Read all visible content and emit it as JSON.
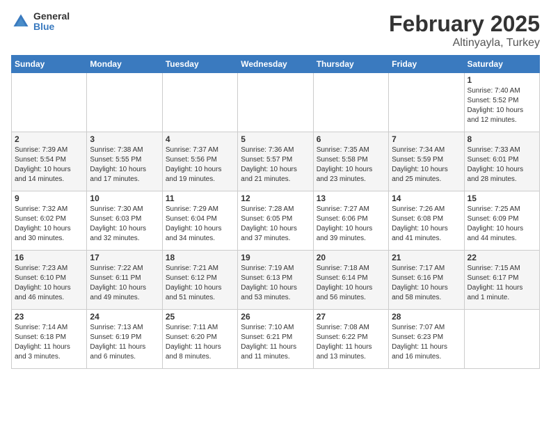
{
  "logo": {
    "general": "General",
    "blue": "Blue"
  },
  "title": "February 2025",
  "subtitle": "Altinyayla, Turkey",
  "days_header": [
    "Sunday",
    "Monday",
    "Tuesday",
    "Wednesday",
    "Thursday",
    "Friday",
    "Saturday"
  ],
  "weeks": [
    [
      {
        "day": "",
        "info": ""
      },
      {
        "day": "",
        "info": ""
      },
      {
        "day": "",
        "info": ""
      },
      {
        "day": "",
        "info": ""
      },
      {
        "day": "",
        "info": ""
      },
      {
        "day": "",
        "info": ""
      },
      {
        "day": "1",
        "info": "Sunrise: 7:40 AM\nSunset: 5:52 PM\nDaylight: 10 hours\nand 12 minutes."
      }
    ],
    [
      {
        "day": "2",
        "info": "Sunrise: 7:39 AM\nSunset: 5:54 PM\nDaylight: 10 hours\nand 14 minutes."
      },
      {
        "day": "3",
        "info": "Sunrise: 7:38 AM\nSunset: 5:55 PM\nDaylight: 10 hours\nand 17 minutes."
      },
      {
        "day": "4",
        "info": "Sunrise: 7:37 AM\nSunset: 5:56 PM\nDaylight: 10 hours\nand 19 minutes."
      },
      {
        "day": "5",
        "info": "Sunrise: 7:36 AM\nSunset: 5:57 PM\nDaylight: 10 hours\nand 21 minutes."
      },
      {
        "day": "6",
        "info": "Sunrise: 7:35 AM\nSunset: 5:58 PM\nDaylight: 10 hours\nand 23 minutes."
      },
      {
        "day": "7",
        "info": "Sunrise: 7:34 AM\nSunset: 5:59 PM\nDaylight: 10 hours\nand 25 minutes."
      },
      {
        "day": "8",
        "info": "Sunrise: 7:33 AM\nSunset: 6:01 PM\nDaylight: 10 hours\nand 28 minutes."
      }
    ],
    [
      {
        "day": "9",
        "info": "Sunrise: 7:32 AM\nSunset: 6:02 PM\nDaylight: 10 hours\nand 30 minutes."
      },
      {
        "day": "10",
        "info": "Sunrise: 7:30 AM\nSunset: 6:03 PM\nDaylight: 10 hours\nand 32 minutes."
      },
      {
        "day": "11",
        "info": "Sunrise: 7:29 AM\nSunset: 6:04 PM\nDaylight: 10 hours\nand 34 minutes."
      },
      {
        "day": "12",
        "info": "Sunrise: 7:28 AM\nSunset: 6:05 PM\nDaylight: 10 hours\nand 37 minutes."
      },
      {
        "day": "13",
        "info": "Sunrise: 7:27 AM\nSunset: 6:06 PM\nDaylight: 10 hours\nand 39 minutes."
      },
      {
        "day": "14",
        "info": "Sunrise: 7:26 AM\nSunset: 6:08 PM\nDaylight: 10 hours\nand 41 minutes."
      },
      {
        "day": "15",
        "info": "Sunrise: 7:25 AM\nSunset: 6:09 PM\nDaylight: 10 hours\nand 44 minutes."
      }
    ],
    [
      {
        "day": "16",
        "info": "Sunrise: 7:23 AM\nSunset: 6:10 PM\nDaylight: 10 hours\nand 46 minutes."
      },
      {
        "day": "17",
        "info": "Sunrise: 7:22 AM\nSunset: 6:11 PM\nDaylight: 10 hours\nand 49 minutes."
      },
      {
        "day": "18",
        "info": "Sunrise: 7:21 AM\nSunset: 6:12 PM\nDaylight: 10 hours\nand 51 minutes."
      },
      {
        "day": "19",
        "info": "Sunrise: 7:19 AM\nSunset: 6:13 PM\nDaylight: 10 hours\nand 53 minutes."
      },
      {
        "day": "20",
        "info": "Sunrise: 7:18 AM\nSunset: 6:14 PM\nDaylight: 10 hours\nand 56 minutes."
      },
      {
        "day": "21",
        "info": "Sunrise: 7:17 AM\nSunset: 6:16 PM\nDaylight: 10 hours\nand 58 minutes."
      },
      {
        "day": "22",
        "info": "Sunrise: 7:15 AM\nSunset: 6:17 PM\nDaylight: 11 hours\nand 1 minute."
      }
    ],
    [
      {
        "day": "23",
        "info": "Sunrise: 7:14 AM\nSunset: 6:18 PM\nDaylight: 11 hours\nand 3 minutes."
      },
      {
        "day": "24",
        "info": "Sunrise: 7:13 AM\nSunset: 6:19 PM\nDaylight: 11 hours\nand 6 minutes."
      },
      {
        "day": "25",
        "info": "Sunrise: 7:11 AM\nSunset: 6:20 PM\nDaylight: 11 hours\nand 8 minutes."
      },
      {
        "day": "26",
        "info": "Sunrise: 7:10 AM\nSunset: 6:21 PM\nDaylight: 11 hours\nand 11 minutes."
      },
      {
        "day": "27",
        "info": "Sunrise: 7:08 AM\nSunset: 6:22 PM\nDaylight: 11 hours\nand 13 minutes."
      },
      {
        "day": "28",
        "info": "Sunrise: 7:07 AM\nSunset: 6:23 PM\nDaylight: 11 hours\nand 16 minutes."
      },
      {
        "day": "",
        "info": ""
      }
    ]
  ]
}
